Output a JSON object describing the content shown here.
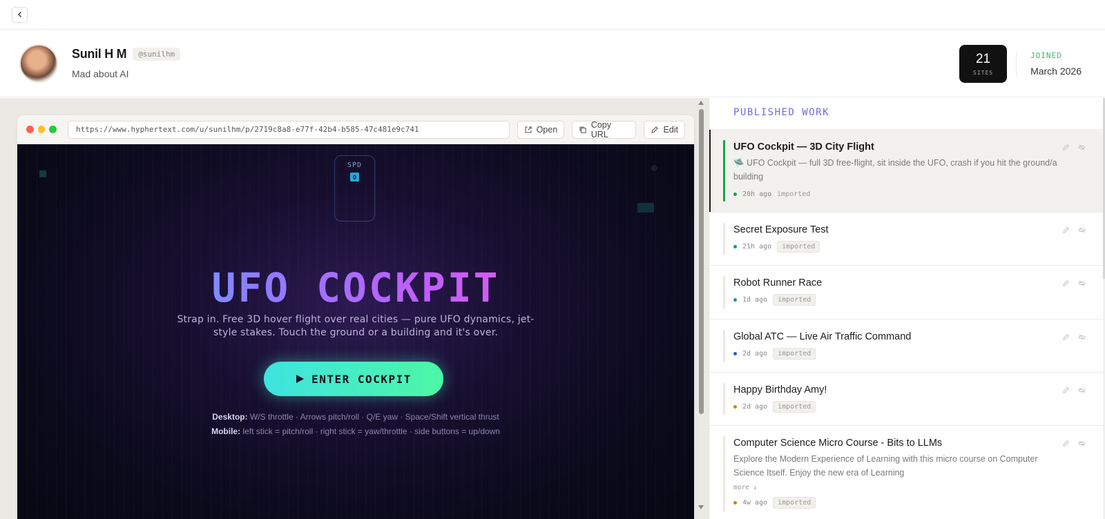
{
  "topbar": {
    "back_icon": "chevron-left-icon"
  },
  "profile": {
    "name": "Sunil H M",
    "handle": "@sunilhm",
    "bio": "Mad about AI",
    "sites_count": "21",
    "sites_label": "SITES",
    "joined_label": "JOINED",
    "joined_value": "March 2026"
  },
  "browser": {
    "url": "https://www.hyphertext.com/u/sunilhm/p/2719c8a8-e77f-42b4-b585-47c481e9c741",
    "open_label": "Open",
    "copy_label": "Copy URL",
    "edit_label": "Edit"
  },
  "preview": {
    "spd_label": "SPD",
    "spd_value": "0",
    "title": "UFO COCKPIT",
    "subtitle": "Strap in. Free 3D hover flight over real cities — pure UFO dynamics, jet-style stakes. Touch the ground or a building and it's over.",
    "enter_label": "ENTER COCKPIT",
    "desktop_label": "Desktop:",
    "desktop_text": "W/S throttle · Arrows pitch/roll · Q/E yaw · Space/Shift vertical thrust",
    "mobile_label": "Mobile:",
    "mobile_text": "left stick = pitch/roll · right stick = yaw/throttle · side buttons = up/down"
  },
  "published": {
    "title": "PUBLISHED WORK",
    "items": [
      {
        "title": "UFO Cockpit — 3D City Flight",
        "desc": "🛸 UFO Cockpit — full 3D free-flight, sit inside the UFO, crash if you hit the ground/a building",
        "time": "20h ago",
        "tag": "imported",
        "dot_color": "#1aa34a"
      },
      {
        "title": "Secret Exposure Test",
        "time": "21h ago",
        "tag": "imported",
        "dot_color": "#1a9a8a"
      },
      {
        "title": "Robot Runner Race",
        "time": "1d ago",
        "tag": "imported",
        "dot_color": "#1a9a8a"
      },
      {
        "title": "Global ATC — Live Air Traffic Command",
        "time": "2d ago",
        "tag": "imported",
        "dot_color": "#2a5dbf"
      },
      {
        "title": "Happy Birthday Amy!",
        "time": "2d ago",
        "tag": "imported",
        "dot_color": "#c08a1a"
      },
      {
        "title": "Computer Science Micro Course - Bits to LLMs",
        "desc": "Explore the Modern Experience of Learning with this micro course on Computer Science Itself. Enjoy the new era of Learning",
        "more": "more ↓",
        "time": "4w ago",
        "tag": "imported",
        "dot_color": "#c08a1a"
      }
    ]
  }
}
